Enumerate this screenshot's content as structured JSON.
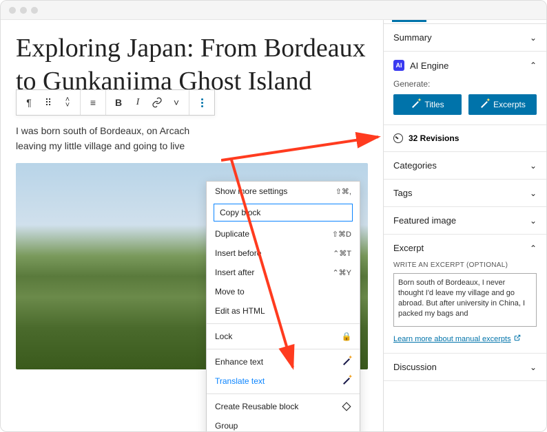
{
  "post_title": "Exploring Japan: From Bordeaux to Gunkanjima Ghost Island",
  "paragraph_visible": "I was born south of Bordeaux, on Arcach\nleaving my little village and going to live",
  "popup": {
    "show_more": "Show more settings",
    "show_more_sc": "⇧⌘,",
    "copy": "Copy block",
    "duplicate": "Duplicate",
    "duplicate_sc": "⇧⌘D",
    "insert_before": "Insert before",
    "insert_before_sc": "⌃⌘T",
    "insert_after": "Insert after",
    "insert_after_sc": "⌃⌘Y",
    "move_to": "Move to",
    "edit_html": "Edit as HTML",
    "lock": "Lock",
    "enhance": "Enhance text",
    "translate": "Translate text",
    "reusable": "Create Reusable block",
    "group": "Group"
  },
  "sidebar": {
    "summary": "Summary",
    "ai_engine": "AI Engine",
    "generate": "Generate:",
    "titles_btn": "Titles",
    "excerpts_btn": "Excerpts",
    "revisions": "32 Revisions",
    "categories": "Categories",
    "tags": "Tags",
    "featured": "Featured image",
    "excerpt": "Excerpt",
    "excerpt_label": "WRITE AN EXCERPT (OPTIONAL)",
    "excerpt_value": "Born south of Bordeaux, I never thought I'd leave my village and go abroad. But after university in China, I packed my bags and",
    "excerpt_link": "Learn more about manual excerpts",
    "discussion": "Discussion"
  }
}
